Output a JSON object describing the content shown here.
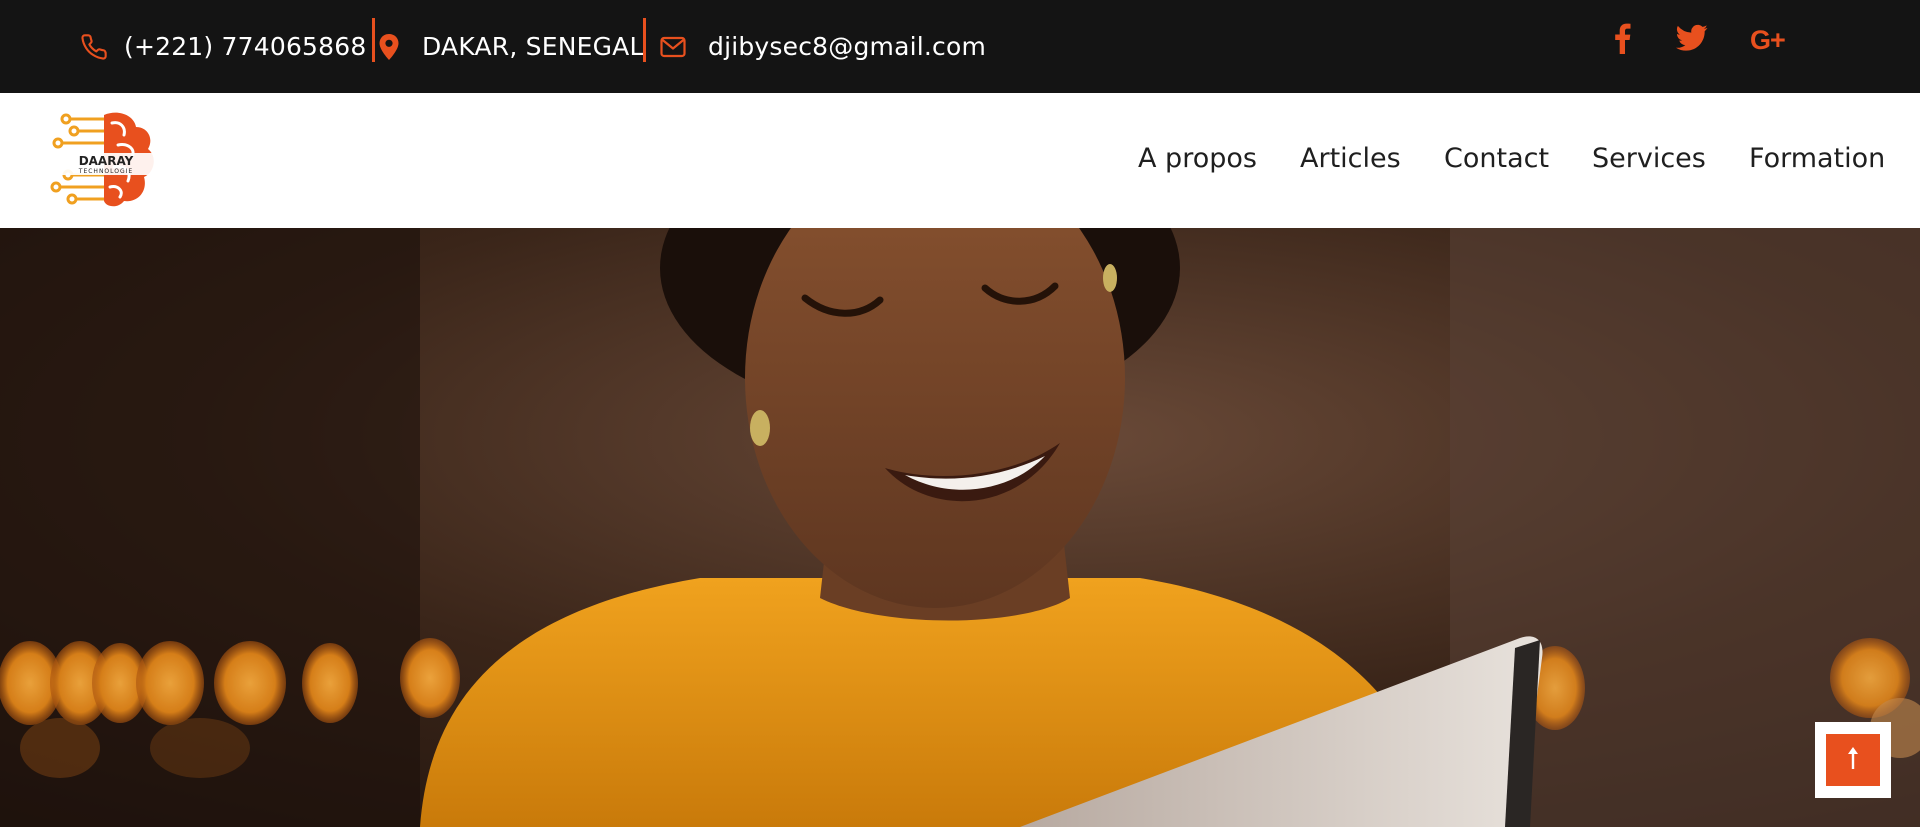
{
  "topbar": {
    "phone": "(+221) 774065868",
    "location": "DAKAR, SENEGAL",
    "email": "djibysec8@gmail.com",
    "icons": {
      "phone": "phone-icon",
      "location": "map-pin-icon",
      "email": "envelope-icon"
    },
    "social": [
      "facebook-icon",
      "twitter-icon",
      "google-plus-icon"
    ],
    "social_google_label": "G+"
  },
  "logo": {
    "line1": "DAARAY",
    "line2": "TECHNOLOGIE"
  },
  "nav": {
    "items": [
      "A propos",
      "Articles",
      "Contact",
      "Services",
      "Formation"
    ]
  },
  "hero": {
    "image": "smiling-woman-with-tablet"
  },
  "scroll_top": {
    "icon": "arrow-up-icon"
  },
  "colors": {
    "accent": "#e8501e",
    "topbar_bg": "#141414",
    "nav_text": "#1f1f1f"
  }
}
